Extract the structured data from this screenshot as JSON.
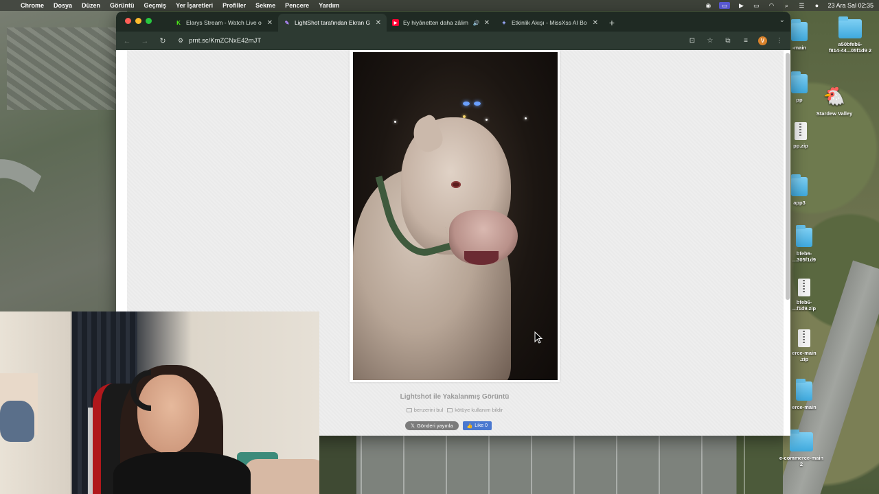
{
  "menubar": {
    "apple": "",
    "app_name": "Chrome",
    "items": [
      "Dosya",
      "Düzen",
      "Görüntü",
      "Geçmiş",
      "Yer İşaretleri",
      "Profiller",
      "Sekme",
      "Pencere",
      "Yardım"
    ],
    "datetime": "23 Ara Sal 02:35"
  },
  "browser": {
    "tabs": [
      {
        "title": "Elarys Stream - Watch Live o",
        "icon": "kick-icon",
        "color": "#53fc18",
        "active": false
      },
      {
        "title": "LightShot tarafından Ekran G",
        "icon": "lightshot-feather-icon",
        "color": "#b388ff",
        "active": true
      },
      {
        "title": "Ey hiyânetten daha zâlim",
        "icon": "youtube-icon",
        "color": "#ff0033",
        "active": false,
        "audio": true
      },
      {
        "title": "Etkinlik Akışı - MissXss AI Bo",
        "icon": "missxss-icon",
        "color": "#9aa9ff",
        "active": false
      }
    ],
    "url": "prnt.sc/KmZCNxE42mJT",
    "profile_initial": "V"
  },
  "page": {
    "caption": "Lightshot ile Yakalanmış Görüntü",
    "link_similar": "benzerini bul",
    "link_report": "kötüye kullanım bildir",
    "tweet_button": "Gönderi yayınla",
    "like_button": "Like 0"
  },
  "desktop_icons": [
    {
      "label": "a50bfeb6-\nf814-44...05f1d9 2",
      "type": "folder"
    },
    {
      "label": "Stardew Valley",
      "type": "game"
    },
    {
      "label": "-main",
      "type": "folder"
    },
    {
      "label": "pp",
      "type": "folder"
    },
    {
      "label": "pp.zip",
      "type": "zip"
    },
    {
      "label": "app3",
      "type": "folder"
    },
    {
      "label": "bfeb6-\n...305f1d9",
      "type": "folder"
    },
    {
      "label": "bfeb6-\n...f1d9.zip",
      "type": "zip"
    },
    {
      "label": "erce-main\n.zip",
      "type": "zip"
    },
    {
      "label": "erce-main",
      "type": "folder"
    },
    {
      "label": "e-commerce-main\n2",
      "type": "folder"
    }
  ],
  "colors": {
    "tab_strip": "#1f2a23",
    "toolbar": "#2d3a32",
    "page_bg": "#eeeeee",
    "like_blue": "#4a78d0"
  }
}
